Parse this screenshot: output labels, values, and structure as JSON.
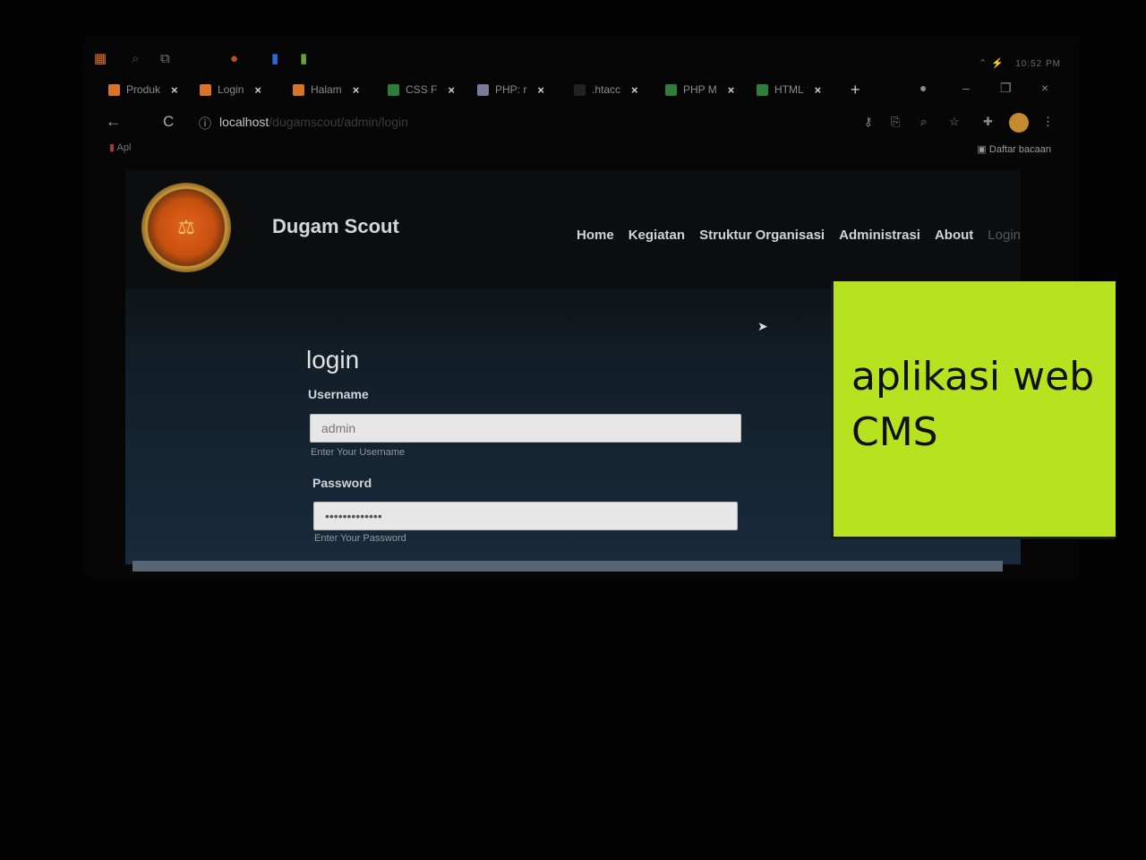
{
  "taskbar": {
    "icons": [
      {
        "name": "windows-start-icon",
        "glyph": "▦",
        "color": "#d9732a"
      },
      {
        "name": "search-icon",
        "glyph": "⌕",
        "color": "#555555"
      },
      {
        "name": "task-view-icon",
        "glyph": "⧉",
        "color": "#777777"
      },
      {
        "name": "browser-icon",
        "glyph": "●",
        "color": "#c0522a"
      },
      {
        "name": "app-icon",
        "glyph": "▮",
        "color": "#2e6bd8"
      },
      {
        "name": "notepad-icon",
        "glyph": "▮",
        "color": "#6f9e3a"
      }
    ],
    "clock": "10:52 PM"
  },
  "tabs": [
    {
      "label": "Produk",
      "favicon": "#d9732a"
    },
    {
      "label": "Login",
      "favicon": "#d9732a"
    },
    {
      "label": "Halam",
      "favicon": "#d9732a"
    },
    {
      "label": "CSS F",
      "favicon": "#2f7d3a"
    },
    {
      "label": "PHP: r",
      "favicon": "#7a7a9a"
    },
    {
      "label": ".htacc",
      "favicon": "#222222"
    },
    {
      "label": "PHP M",
      "favicon": "#2f7d3a"
    },
    {
      "label": "HTML",
      "favicon": "#2f7d3a"
    }
  ],
  "tab_close": "×",
  "new_tab": "+",
  "window_controls": {
    "minimize": "–",
    "restore": "❐",
    "close": "×"
  },
  "address_bar": {
    "back": "←",
    "reload": "C",
    "info": "ⓘ",
    "host": "localhost",
    "path": "/dugamscout/admin/login",
    "extensions": [
      "⚷",
      "⎘",
      "⌕",
      "☆",
      "✚"
    ],
    "menu": "⋮"
  },
  "bookmarks": {
    "apps_label": "Apl",
    "reading_list": "Daftar bacaan"
  },
  "site": {
    "logo_glyph": "⚖",
    "brand": "Dugam Scout",
    "menu": [
      "Home",
      "Kegiatan",
      "Struktur Organisasi",
      "Administrasi",
      "About",
      "Login"
    ]
  },
  "form": {
    "title": "login",
    "username_label": "Username",
    "username_value": "admin",
    "username_hint": "Enter Your Username",
    "password_label": "Password",
    "password_value": "•••••••••••••",
    "password_hint": "Enter Your Password"
  },
  "overlay": {
    "line1": "aplikasi web",
    "line2": "CMS"
  },
  "colors": {
    "overlay_bg": "#b6e220",
    "site_header": "#0b0d0e",
    "accent_orange": "#d9732a"
  }
}
